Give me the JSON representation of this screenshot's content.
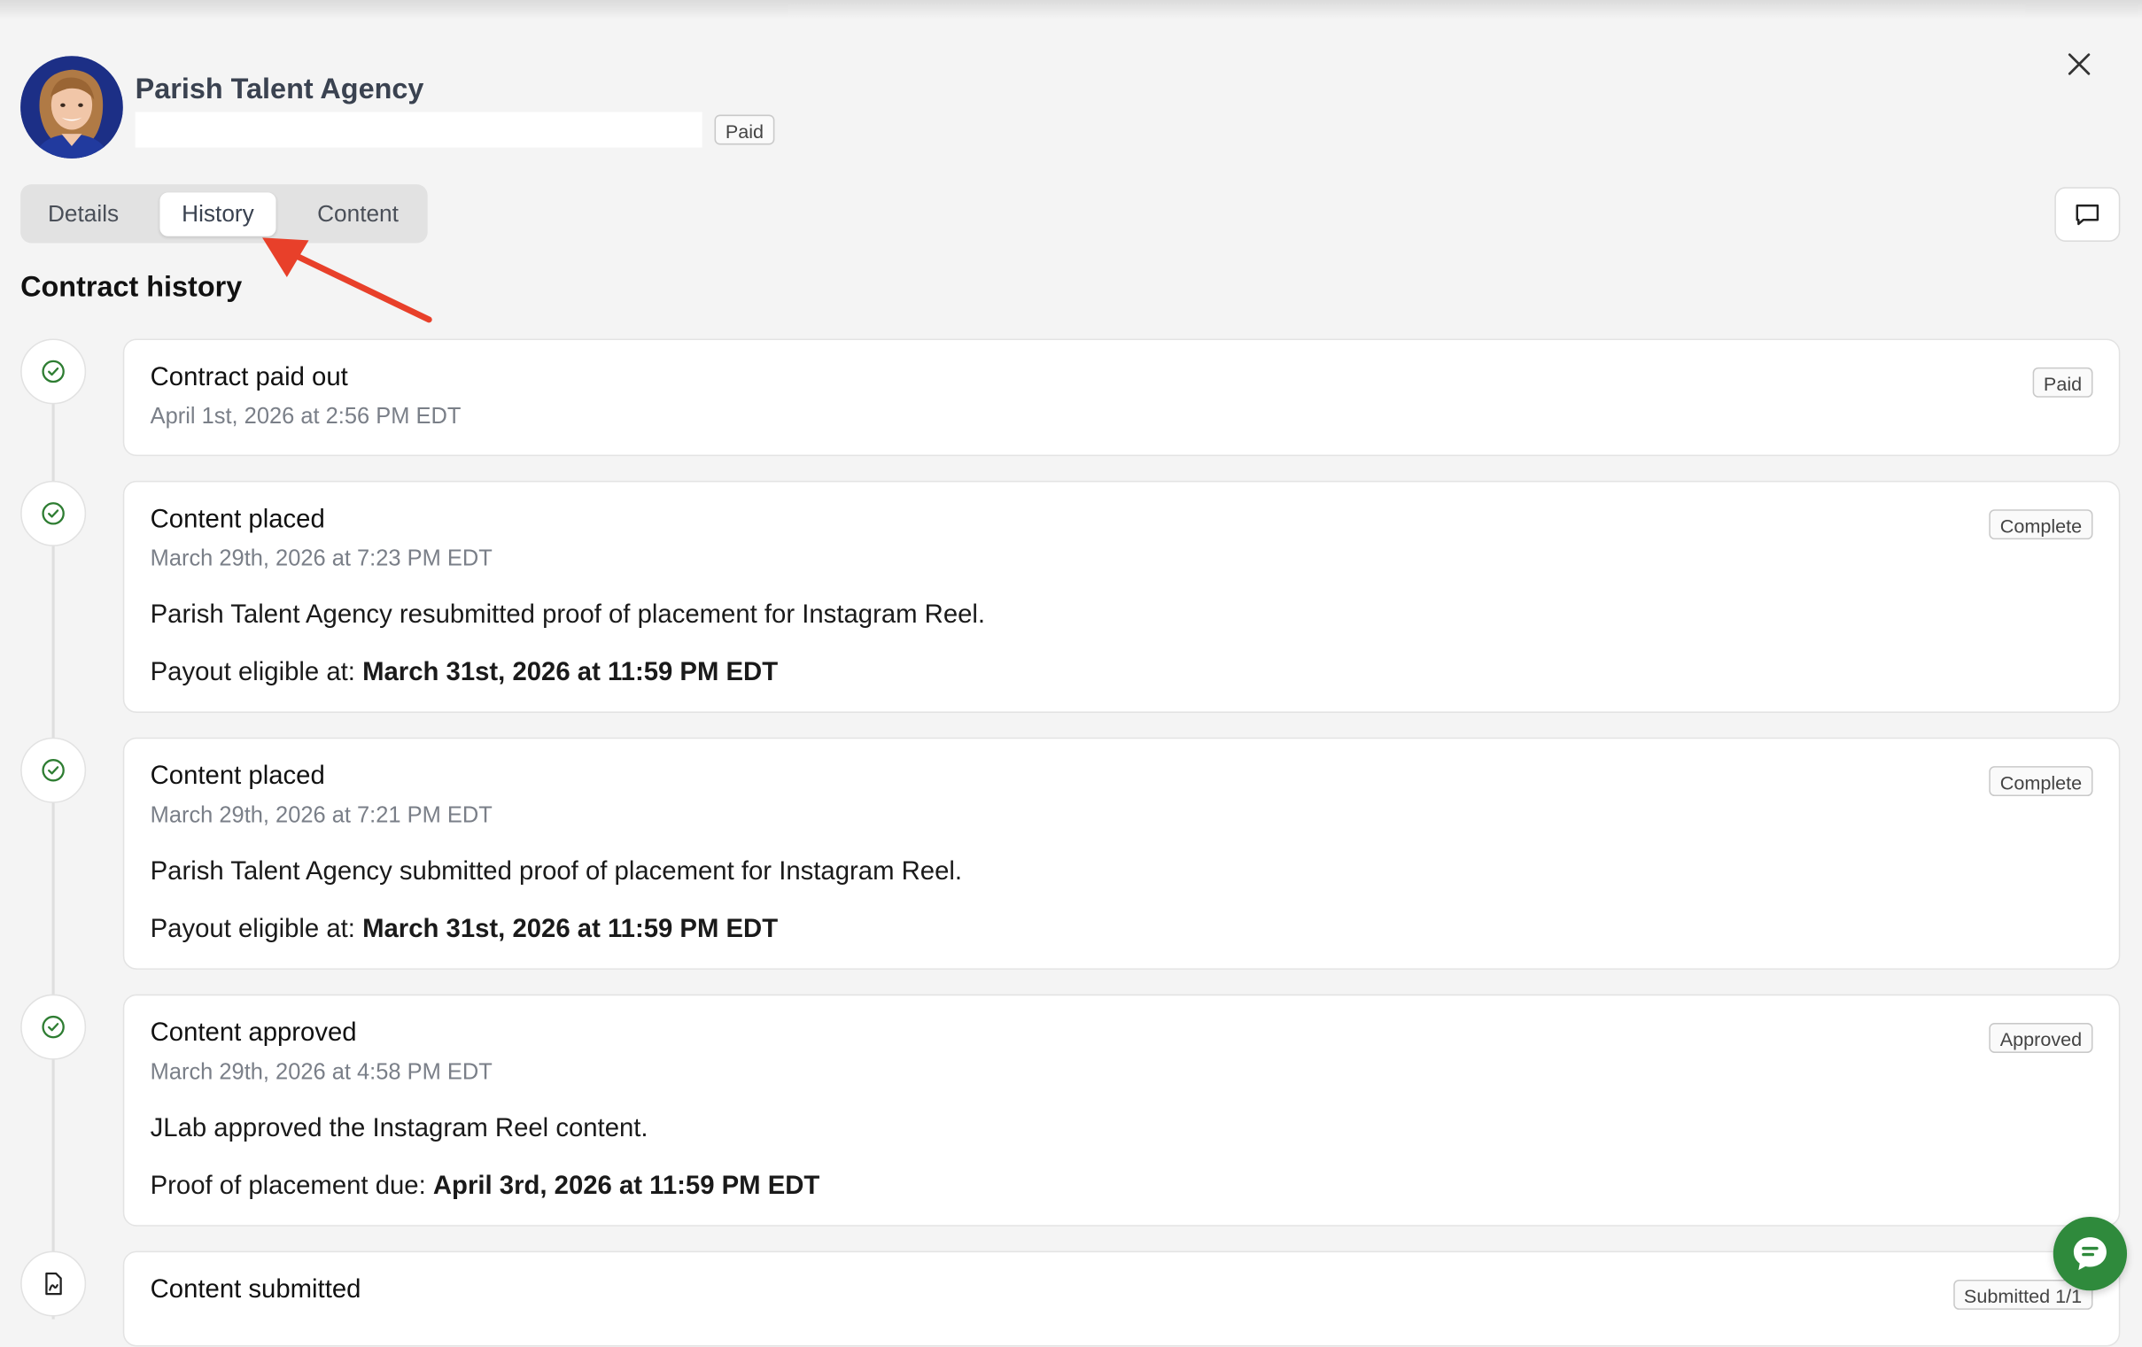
{
  "header": {
    "agency_name": "Parish Talent Agency",
    "status_badge": "Paid"
  },
  "tabs": [
    {
      "label": "Details",
      "active": false
    },
    {
      "label": "History",
      "active": true
    },
    {
      "label": "Content",
      "active": false
    }
  ],
  "section_title": "Contract history",
  "history": [
    {
      "title": "Contract paid out",
      "date": "April 1st, 2026 at 2:56 PM EDT",
      "badge": "Paid",
      "icon": "check-circle-icon"
    },
    {
      "title": "Content placed",
      "date": "March 29th, 2026 at 7:23 PM EDT",
      "badge": "Complete",
      "icon": "check-circle-icon",
      "message": "Parish Talent Agency resubmitted proof of placement for Instagram Reel.",
      "detail_label": "Payout eligible at:",
      "detail_value": "March 31st, 2026 at 11:59 PM EDT"
    },
    {
      "title": "Content placed",
      "date": "March 29th, 2026 at 7:21 PM EDT",
      "badge": "Complete",
      "icon": "check-circle-icon",
      "message": "Parish Talent Agency submitted proof of placement for Instagram Reel.",
      "detail_label": "Payout eligible at:",
      "detail_value": "March 31st, 2026 at 11:59 PM EDT"
    },
    {
      "title": "Content approved",
      "date": "March 29th, 2026 at 4:58 PM EDT",
      "badge": "Approved",
      "icon": "check-circle-icon",
      "message": "JLab approved the Instagram Reel content.",
      "detail_label": "Proof of placement due:",
      "detail_value": "April 3rd, 2026 at 11:59 PM EDT"
    },
    {
      "title": "Content submitted",
      "badge": "Submitted 1/1",
      "icon": "file-signature-icon"
    }
  ],
  "colors": {
    "page_bg": "#f4f4f4",
    "success_green": "#2e7d32",
    "annotation_arrow": "#e8402a",
    "chat_button": "#2f8a3c"
  }
}
